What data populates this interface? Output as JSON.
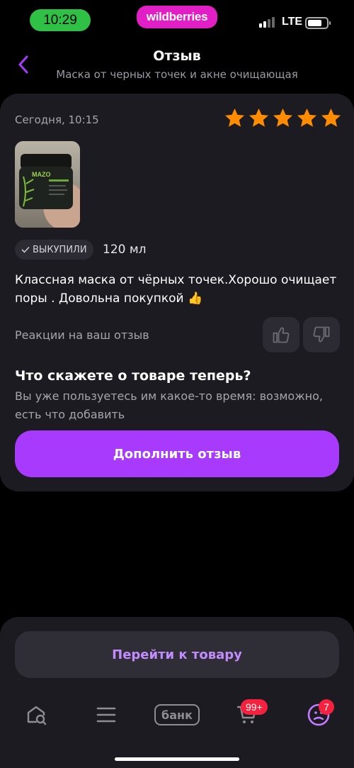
{
  "status_bar": {
    "time": "10:29",
    "brand": "wildberries",
    "network": "LTE"
  },
  "header": {
    "title": "Отзыв",
    "subtitle": "Маска от черных точек и акне очищающая",
    "back_icon": "chevron-left-icon"
  },
  "review": {
    "date": "Сегодня, 10:15",
    "rating": 5,
    "rating_max": 5,
    "star_color": "#ff8c00",
    "photo_label": "MAZO",
    "purchased_badge": "ВЫКУПИЛИ",
    "volume": "120 мл",
    "text": "Классная маска от чёрных точек.Хорошо очищает поры . Довольна покупкой 👍",
    "reactions_label": "Реакции на ваш отзыв"
  },
  "prompt": {
    "title": "Что скажете о товаре теперь?",
    "text": "Вы уже пользуетесь им какое-то время: возможно, есть что добавить",
    "button": "Дополнить отзыв",
    "button_color": "#a73afd"
  },
  "bottom": {
    "goto_button": "Перейти к товару",
    "tabs": {
      "home_icon": "home-search-icon",
      "catalog_icon": "menu-icon",
      "bank_label": "банк",
      "cart_icon": "cart-icon",
      "cart_badge": "99+",
      "profile_icon": "profile-icon",
      "profile_badge": "7"
    }
  }
}
